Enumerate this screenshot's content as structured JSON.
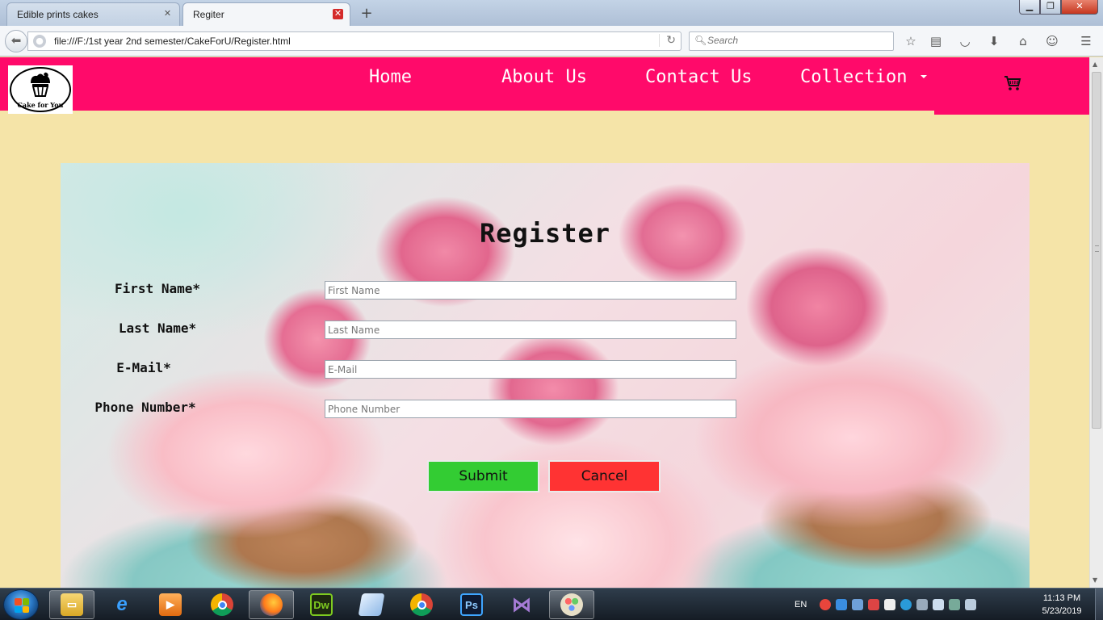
{
  "browser": {
    "tabs": [
      {
        "title": "Edible prints cakes",
        "active": false
      },
      {
        "title": "Regiter",
        "active": true
      }
    ],
    "new_tab": "+",
    "url": "file:///F:/1st year 2nd semester/CakeForU/Register.html",
    "search_placeholder": "Search",
    "window_buttons": {
      "minimize": "▁",
      "restore": "❐",
      "close": "✕"
    }
  },
  "site": {
    "logo_text": "Cake for You",
    "nav": [
      {
        "label": "Home"
      },
      {
        "label": "About Us"
      },
      {
        "label": "Contact Us"
      },
      {
        "label": "Collection"
      }
    ],
    "header_color": "#ff0a6a",
    "page_bg": "#f5e4a8"
  },
  "form": {
    "title": "Register",
    "fields": [
      {
        "label": "First Name*",
        "placeholder": "First Name",
        "value": ""
      },
      {
        "label": "Last Name*",
        "placeholder": "Last Name",
        "value": ""
      },
      {
        "label": "E-Mail*",
        "placeholder": "E-Mail",
        "value": ""
      },
      {
        "label": "Phone Number*",
        "placeholder": "Phone Number",
        "value": ""
      }
    ],
    "submit_label": "Submit",
    "cancel_label": "Cancel",
    "submit_color": "#33cc33",
    "cancel_color": "#ff3333"
  },
  "taskbar": {
    "apps": [
      {
        "icon": "file-explorer-icon",
        "active": true
      },
      {
        "icon": "internet-explorer-icon",
        "active": false
      },
      {
        "icon": "media-player-icon",
        "active": false
      },
      {
        "icon": "chrome-icon",
        "active": false
      },
      {
        "icon": "firefox-icon",
        "active": true
      },
      {
        "icon": "dreamweaver-icon",
        "label": "Dw",
        "active": false
      },
      {
        "icon": "notepad-icon",
        "active": false
      },
      {
        "icon": "chrome-alt-icon",
        "active": false
      },
      {
        "icon": "photoshop-icon",
        "label": "Ps",
        "active": false
      },
      {
        "icon": "visual-studio-icon",
        "active": false
      },
      {
        "icon": "paint-icon",
        "active": true
      }
    ],
    "language": "EN",
    "time": "11:13 PM",
    "date": "5/23/2019"
  }
}
